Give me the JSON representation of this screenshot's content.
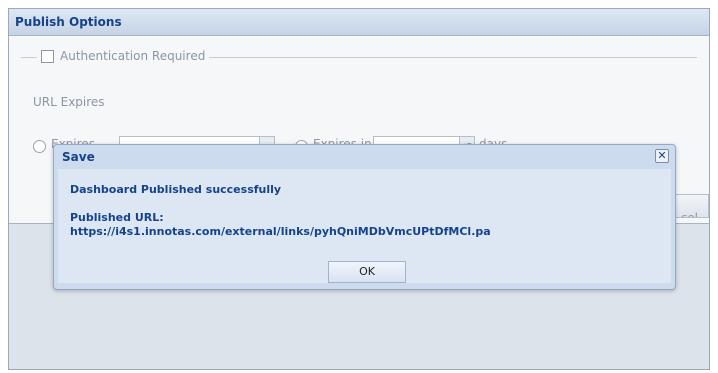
{
  "panel": {
    "title": "Publish Options",
    "auth_label": "Authentication Required",
    "url_expires_label": "URL Expires",
    "radio1_label": "Expires",
    "radio2_label": "Expires in",
    "days_label": "days",
    "spinner_glyph": "▴▾",
    "cancel_fragment": "cel"
  },
  "dialog": {
    "title": "Save",
    "close_glyph": "✕",
    "success_message": "Dashboard Published successfully",
    "url_label": "Published URL:",
    "url_value": "https://i4s1.innotas.com/external/links/pyhQniMDbVmcUPtDfMCl.pa",
    "ok_label": "OK"
  },
  "colors": {
    "header_text": "#15428b",
    "dialog_bg": "#ccdbee",
    "panel_bg": "#f6f7f9"
  }
}
